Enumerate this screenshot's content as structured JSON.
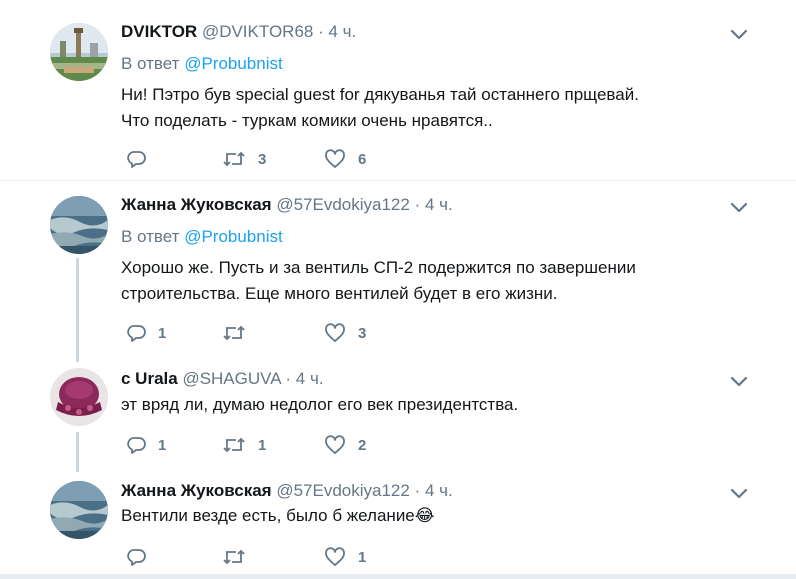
{
  "tweets": [
    {
      "name": "DVIKTOR",
      "handle": "@DVIKTOR68",
      "dot": "·",
      "time": "4 ч.",
      "reply_prefix": "В ответ",
      "reply_handle": "@Probubnist",
      "text": "Ни! Пэтро був special guest for дякуванья тай останнего прщевай.\nЧто поделать - туркам комики очень нравятся..",
      "replies": "",
      "retweets": "3",
      "likes": "6"
    },
    {
      "name": "Жанна Жуковская",
      "handle": "@57Evdokiya122",
      "dot": "·",
      "time": "4 ч.",
      "reply_prefix": "В ответ",
      "reply_handle": "@Probubnist",
      "text": "Хорошо же. Пусть и за вентиль СП-2 подержится по завершении\nстроительства. Еще много вентилей будет в его жизни.",
      "replies": "1",
      "retweets": "",
      "likes": "3"
    },
    {
      "name": "с Urala",
      "handle": "@SHAGUVA",
      "dot": "·",
      "time": "4 ч.",
      "text": "эт вряд ли, думаю недолог его век президентства.",
      "replies": "1",
      "retweets": "1",
      "likes": "2"
    },
    {
      "name": "Жанна Жуковская",
      "handle": "@57Evdokiya122",
      "dot": "·",
      "time": "4 ч.",
      "text": "Вентили везде есть, было б желание😂",
      "replies": "",
      "retweets": "",
      "likes": "1"
    }
  ],
  "icons": {
    "reply": "reply-icon",
    "retweet": "retweet-icon",
    "like": "heart-icon",
    "menu": "chevron-down-icon"
  },
  "colors": {
    "link": "#1da1f2",
    "secondary": "#657786",
    "thread_line": "#ccd6dd",
    "divider": "#e6ecf0"
  }
}
